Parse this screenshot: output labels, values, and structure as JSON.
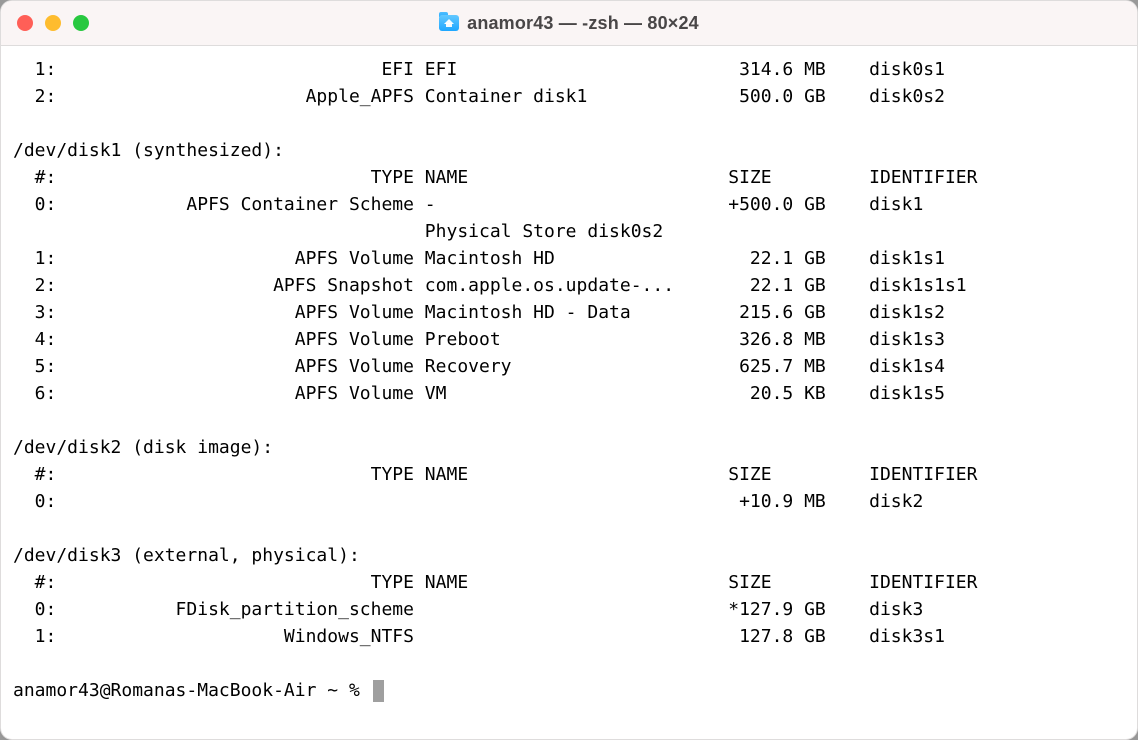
{
  "window": {
    "title": "anamor43 — -zsh — 80×24"
  },
  "prompt": "anamor43@Romanas-MacBook-Air ~ % ",
  "cols": {
    "num_pad": 4,
    "type_width": 33,
    "name_width": 27,
    "size_width": 10,
    "gap": "    ",
    "size_hdr_pad": 1
  },
  "top_rows": [
    {
      "num": "1:",
      "type": "EFI",
      "name": "EFI",
      "size": "314.6 MB",
      "ident": "disk0s1"
    },
    {
      "num": "2:",
      "type": "Apple_APFS",
      "name": "Container disk1",
      "size": "500.0 GB",
      "ident": "disk0s2"
    }
  ],
  "sections": [
    {
      "header": "/dev/disk1 (synthesized):",
      "columns": {
        "size": "SIZE",
        "ident": "IDENTIFIER",
        "type": "TYPE",
        "name": "NAME"
      },
      "rows": [
        {
          "num": "0:",
          "type": "APFS Container Scheme",
          "name": "-",
          "size": "+500.0 GB",
          "ident": "disk1"
        },
        {
          "num": "",
          "type": "",
          "name": "Physical Store disk0s2",
          "size": "",
          "ident": ""
        },
        {
          "num": "1:",
          "type": "APFS Volume",
          "name": "Macintosh HD",
          "size": "22.1 GB",
          "ident": "disk1s1"
        },
        {
          "num": "2:",
          "type": "APFS Snapshot",
          "name": "com.apple.os.update-...",
          "size": "22.1 GB",
          "ident": "disk1s1s1"
        },
        {
          "num": "3:",
          "type": "APFS Volume",
          "name": "Macintosh HD - Data",
          "size": "215.6 GB",
          "ident": "disk1s2"
        },
        {
          "num": "4:",
          "type": "APFS Volume",
          "name": "Preboot",
          "size": "326.8 MB",
          "ident": "disk1s3"
        },
        {
          "num": "5:",
          "type": "APFS Volume",
          "name": "Recovery",
          "size": "625.7 MB",
          "ident": "disk1s4"
        },
        {
          "num": "6:",
          "type": "APFS Volume",
          "name": "VM",
          "size": "20.5 KB",
          "ident": "disk1s5"
        }
      ]
    },
    {
      "header": "/dev/disk2 (disk image):",
      "columns": {
        "size": "SIZE",
        "ident": "IDENTIFIER",
        "type": "TYPE",
        "name": "NAME"
      },
      "rows": [
        {
          "num": "0:",
          "type": "",
          "name": "",
          "size": "+10.9 MB",
          "ident": "disk2"
        }
      ]
    },
    {
      "header": "/dev/disk3 (external, physical):",
      "columns": {
        "size": "SIZE",
        "ident": "IDENTIFIER",
        "type": "TYPE",
        "name": "NAME"
      },
      "rows": [
        {
          "num": "0:",
          "type": "FDisk_partition_scheme",
          "name": "",
          "size": "*127.9 GB",
          "ident": "disk3"
        },
        {
          "num": "1:",
          "type": "Windows_NTFS",
          "name": "",
          "size": "127.8 GB",
          "ident": "disk3s1"
        }
      ]
    }
  ]
}
